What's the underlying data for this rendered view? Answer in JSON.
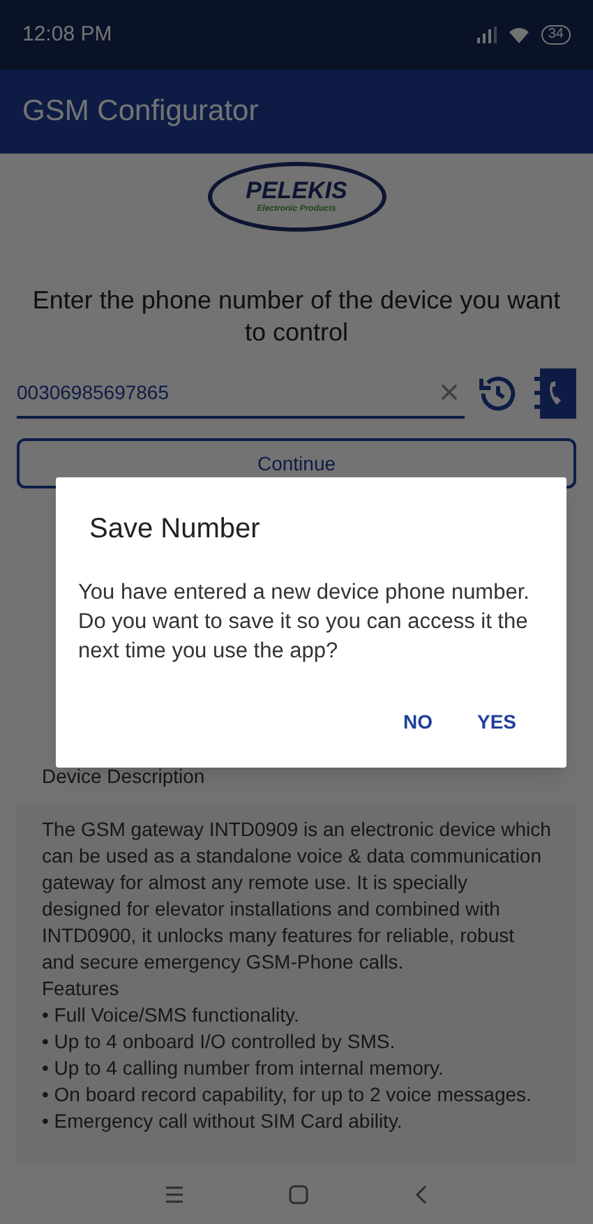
{
  "status_bar": {
    "time": "12:08 PM",
    "battery": "34"
  },
  "app_bar": {
    "title": "GSM Configurator"
  },
  "logo": {
    "name": "PELEKIS",
    "tagline": "Electronic Products"
  },
  "prompt": "Enter the phone number of the device you want to control",
  "phone_field": {
    "value": "00306985697865"
  },
  "continue_button": "Continue",
  "description": {
    "heading": "Device Description",
    "body": "The GSM gateway INTD0909 is an electronic device which can be used as a standalone voice & data communication gateway for almost any remote use. It is specially designed for elevator installations and combined with INTD0900, it unlocks many features for reliable, robust and secure emergency GSM-Phone calls.",
    "features_heading": "Features",
    "features": [
      "• Full Voice/SMS functionality.",
      "• Up to 4 onboard I/O controlled by SMS.",
      "• Up to 4 calling number from internal memory.",
      "• On board record capability, for up to 2 voice messages.",
      "• Emergency call without SIM Card ability."
    ]
  },
  "dialog": {
    "title": "Save Number",
    "message": "You have entered a new device phone number. Do you want to save it so you can access it the next time you use the app?",
    "buttons": [
      "NO",
      "YES"
    ]
  }
}
